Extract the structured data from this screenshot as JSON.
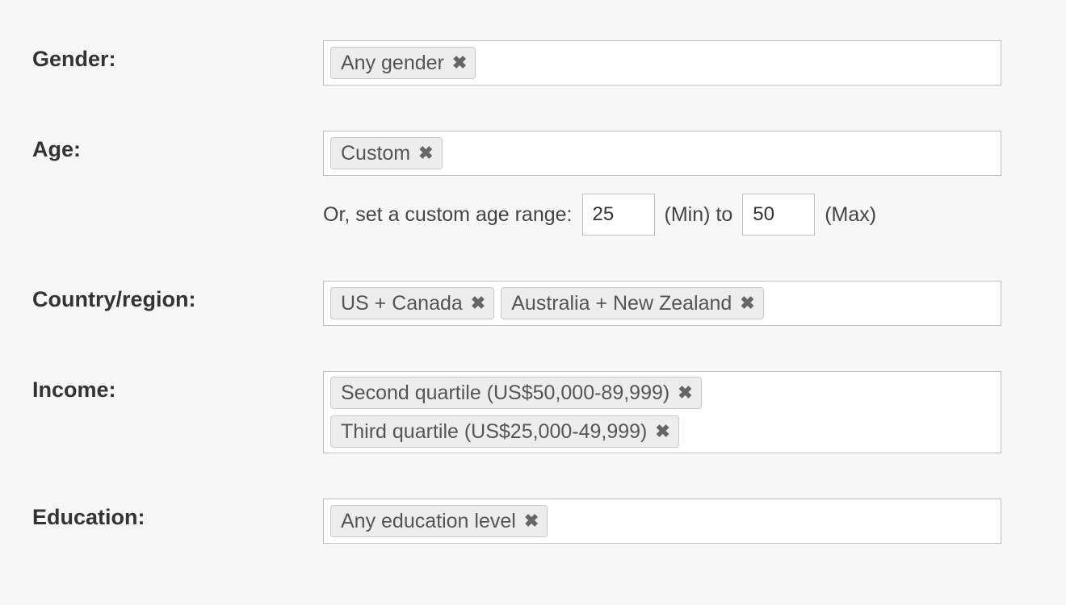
{
  "gender": {
    "label": "Gender:",
    "tags": [
      "Any gender"
    ]
  },
  "age": {
    "label": "Age:",
    "tags": [
      "Custom"
    ],
    "custom_prompt": "Or, set a custom age range:",
    "min_value": "25",
    "min_label": "(Min) to",
    "max_value": "50",
    "max_label": "(Max)"
  },
  "country": {
    "label": "Country/region:",
    "tags": [
      "US + Canada",
      "Australia + New Zealand"
    ]
  },
  "income": {
    "label": "Income:",
    "tags": [
      "Second quartile (US$50,000-89,999)",
      "Third quartile (US$25,000-49,999)"
    ]
  },
  "education": {
    "label": "Education:",
    "tags": [
      "Any education level"
    ]
  }
}
